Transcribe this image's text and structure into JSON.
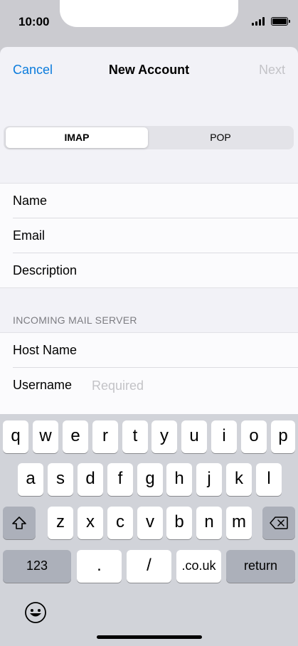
{
  "status_bar": {
    "time": "10:00"
  },
  "nav": {
    "cancel": "Cancel",
    "title": "New Account",
    "next": "Next"
  },
  "segmented": {
    "options": [
      "IMAP",
      "POP"
    ],
    "selected": "IMAP"
  },
  "form": {
    "fields": [
      {
        "label": "Name",
        "placeholder": ""
      },
      {
        "label": "Email",
        "placeholder": ""
      },
      {
        "label": "Description",
        "placeholder": ""
      }
    ],
    "incoming_header": "INCOMING MAIL SERVER",
    "incoming": [
      {
        "label": "Host Name",
        "placeholder": ""
      },
      {
        "label": "Username",
        "placeholder": "Required"
      }
    ]
  },
  "keyboard": {
    "row1": [
      "q",
      "w",
      "e",
      "r",
      "t",
      "y",
      "u",
      "i",
      "o",
      "p"
    ],
    "row2": [
      "a",
      "s",
      "d",
      "f",
      "g",
      "h",
      "j",
      "k",
      "l"
    ],
    "row3": [
      "z",
      "x",
      "c",
      "v",
      "b",
      "n",
      "m"
    ],
    "numbers": "123",
    "dot": ".",
    "slash": "/",
    "domain": ".co.uk",
    "return": "return"
  },
  "colors": {
    "accent": "#0a7bdc",
    "disabled": "#c3c3c7",
    "placeholder": "#c3c3c7"
  }
}
